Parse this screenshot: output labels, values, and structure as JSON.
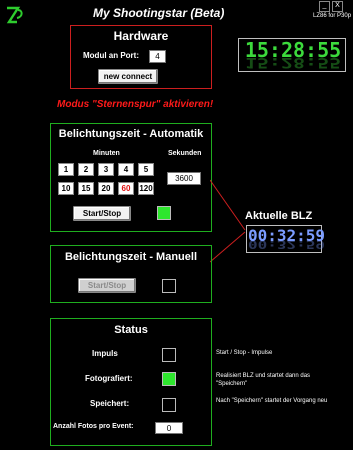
{
  "app": {
    "title": "My Shootingstar (Beta)",
    "subtitle": "LZ86 for P30p",
    "min_glyph": "_",
    "close_glyph": "X"
  },
  "hardware": {
    "title": "Hardware",
    "port_label": "Modul an Port:",
    "port_value": "4",
    "connect_button": "new connect"
  },
  "clock": {
    "time": "15:28:55"
  },
  "mode_message": "Modus \"Sternenspur\" aktivieren!",
  "auto": {
    "title": "Belichtungszeit - Automatik",
    "minutes_label": "Minuten",
    "seconds_label": "Sekunden",
    "minutes_row1": [
      "1",
      "2",
      "3",
      "4",
      "5"
    ],
    "minutes_row2": [
      "10",
      "15",
      "20",
      "60",
      "120"
    ],
    "highlighted_minute": "60",
    "seconds_value": "3600",
    "start_stop_button": "Start/Stop",
    "active": true
  },
  "blz": {
    "label": "Aktuelle BLZ",
    "time": "00:32:59"
  },
  "manual": {
    "title": "Belichtungszeit - Manuell",
    "start_stop_button": "Start/Stop",
    "active": false
  },
  "status": {
    "title": "Status",
    "impuls_label": "Impuls",
    "impuls_note": "Start / Stop - Impulse",
    "impuls_on": false,
    "foto_label": "Fotografiert:",
    "foto_note": "Realisiert BLZ und startet dann das \"Speichern\"",
    "foto_on": true,
    "save_label": "Speichert:",
    "save_note": "Nach \"Speichern\" startet der Vorgang neu",
    "save_on": false,
    "count_label": "Anzahl Fotos pro Event:",
    "count_value": "0"
  },
  "colors": {
    "hardware_border": "#cc1f1f",
    "panel_border": "#1fae1f",
    "clock_green": "#3cdb3c",
    "blz_blue": "#7b9cff",
    "alert_red": "#ff1a1a"
  }
}
